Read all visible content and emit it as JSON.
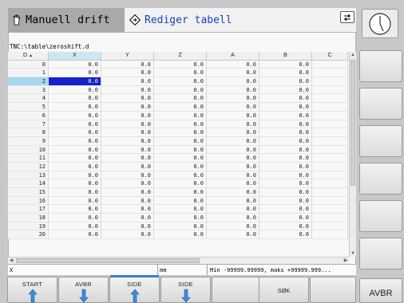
{
  "header": {
    "machine_mode": "Manuell drift",
    "program_mode": "Rediger tabell"
  },
  "table": {
    "path": "TNC:\\table\\zeroshift.d",
    "columns": [
      "D",
      "X",
      "Y",
      "Z",
      "A",
      "B",
      "C"
    ],
    "selected_row": 2,
    "rows": [
      {
        "D": "0",
        "X": "0.0",
        "Y": "0.0",
        "Z": "0.0",
        "A": "0.0",
        "B": "0.0",
        "C": ""
      },
      {
        "D": "1",
        "X": "0.0",
        "Y": "0.0",
        "Z": "0.0",
        "A": "0.0",
        "B": "0.0",
        "C": ""
      },
      {
        "D": "2",
        "X": "0.0",
        "Y": "0.0",
        "Z": "0.0",
        "A": "0.0",
        "B": "0.0",
        "C": ""
      },
      {
        "D": "3",
        "X": "0.0",
        "Y": "0.0",
        "Z": "0.0",
        "A": "0.0",
        "B": "0.0",
        "C": ""
      },
      {
        "D": "4",
        "X": "0.0",
        "Y": "0.0",
        "Z": "0.0",
        "A": "0.0",
        "B": "0.0",
        "C": ""
      },
      {
        "D": "5",
        "X": "0.0",
        "Y": "0.0",
        "Z": "0.0",
        "A": "0.0",
        "B": "0.0",
        "C": ""
      },
      {
        "D": "6",
        "X": "0.0",
        "Y": "0.0",
        "Z": "0.0",
        "A": "0.0",
        "B": "0.0",
        "C": ""
      },
      {
        "D": "7",
        "X": "0.0",
        "Y": "0.0",
        "Z": "0.0",
        "A": "0.0",
        "B": "0.0",
        "C": ""
      },
      {
        "D": "8",
        "X": "0.0",
        "Y": "0.0",
        "Z": "0.0",
        "A": "0.0",
        "B": "0.0",
        "C": ""
      },
      {
        "D": "9",
        "X": "0.0",
        "Y": "0.0",
        "Z": "0.0",
        "A": "0.0",
        "B": "0.0",
        "C": ""
      },
      {
        "D": "10",
        "X": "0.0",
        "Y": "0.0",
        "Z": "0.0",
        "A": "0.0",
        "B": "0.0",
        "C": ""
      },
      {
        "D": "11",
        "X": "0.0",
        "Y": "0.0",
        "Z": "0.0",
        "A": "0.0",
        "B": "0.0",
        "C": ""
      },
      {
        "D": "12",
        "X": "0.0",
        "Y": "0.0",
        "Z": "0.0",
        "A": "0.0",
        "B": "0.0",
        "C": ""
      },
      {
        "D": "13",
        "X": "0.0",
        "Y": "0.0",
        "Z": "0.0",
        "A": "0.0",
        "B": "0.0",
        "C": ""
      },
      {
        "D": "14",
        "X": "0.0",
        "Y": "0.0",
        "Z": "0.0",
        "A": "0.0",
        "B": "0.0",
        "C": ""
      },
      {
        "D": "15",
        "X": "0.0",
        "Y": "0.0",
        "Z": "0.0",
        "A": "0.0",
        "B": "0.0",
        "C": ""
      },
      {
        "D": "16",
        "X": "0.0",
        "Y": "0.0",
        "Z": "0.0",
        "A": "0.0",
        "B": "0.0",
        "C": ""
      },
      {
        "D": "17",
        "X": "0.0",
        "Y": "0.0",
        "Z": "0.0",
        "A": "0.0",
        "B": "0.0",
        "C": ""
      },
      {
        "D": "18",
        "X": "0.0",
        "Y": "0.0",
        "Z": "0.0",
        "A": "0.0",
        "B": "0.0",
        "C": ""
      },
      {
        "D": "19",
        "X": "0.0",
        "Y": "0.0",
        "Z": "0.0",
        "A": "0.0",
        "B": "0.0",
        "C": ""
      },
      {
        "D": "20",
        "X": "0.0",
        "Y": "0.0",
        "Z": "0.0",
        "A": "0.0",
        "B": "0.0",
        "C": ""
      }
    ]
  },
  "status": {
    "field": "X",
    "unit": "mm",
    "range": "Min -99999.99999, maks +99999.999..."
  },
  "softkeys_bottom": [
    {
      "label": "START",
      "icon": "arrow-up-icon",
      "active": false
    },
    {
      "label": "AVBR",
      "icon": "arrow-down-icon",
      "active": false
    },
    {
      "label": "SIDE",
      "icon": "arrow-up-icon",
      "active": true
    },
    {
      "label": "SIDE",
      "icon": "arrow-down-icon",
      "active": false
    },
    {
      "label": "",
      "icon": "",
      "active": false
    },
    {
      "label": "SØK",
      "icon": "",
      "active": false
    },
    {
      "label": "",
      "icon": "",
      "active": false
    }
  ],
  "softkey_right_bottom": "AVBR",
  "icons": {
    "machine_mode": "hand-icon",
    "program_mode": "edit-diamond-icon",
    "swap": "swap-screen-icon",
    "clock": "clock-icon"
  },
  "colors": {
    "selection": "#1620cc",
    "header_program": "#1a3fc0",
    "active_softkey": "#3a7fd0"
  }
}
